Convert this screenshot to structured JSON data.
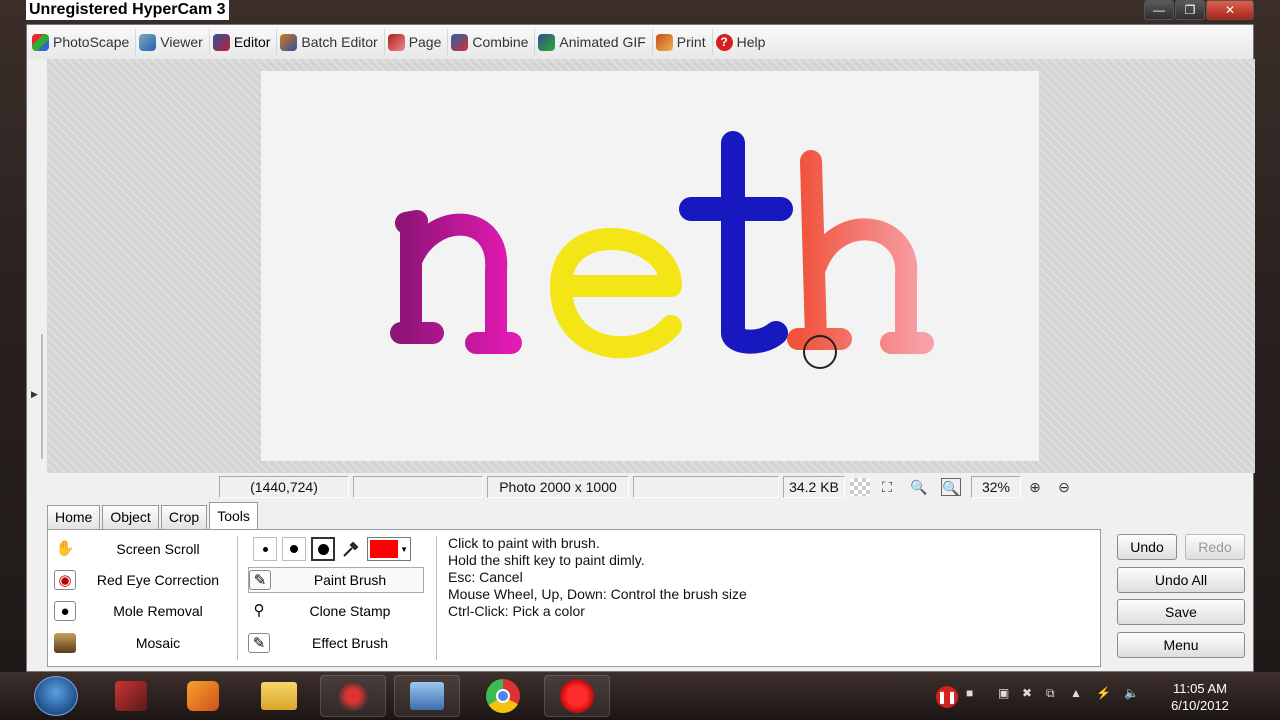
{
  "recorder": {
    "watermark": "Unregistered HyperCam 3"
  },
  "window_controls": {
    "minimize": "—",
    "maximize": "❐",
    "close": "✕"
  },
  "menu": {
    "items": [
      {
        "label": "PhotoScape",
        "icon": "photoscape-icon",
        "color": "#3a8f3a"
      },
      {
        "label": "Viewer",
        "icon": "viewer-icon",
        "color": "#3b6fb6"
      },
      {
        "label": "Editor",
        "icon": "editor-icon",
        "color": "#2d4fa0"
      },
      {
        "label": "Batch Editor",
        "icon": "batch-editor-icon",
        "color": "#d07a1a"
      },
      {
        "label": "Page",
        "icon": "page-icon",
        "color": "#b02020"
      },
      {
        "label": "Combine",
        "icon": "combine-icon",
        "color": "#2a5fb0"
      },
      {
        "label": "Animated GIF",
        "icon": "animated-gif-icon",
        "color": "#2a4f8a"
      },
      {
        "label": "Print",
        "icon": "print-icon",
        "color": "#c0501a"
      },
      {
        "label": "Help",
        "icon": "help-icon",
        "color": "#d62020"
      }
    ]
  },
  "photo": {
    "text": "neth",
    "letter_colors": [
      "#b0108a",
      "#f0e000",
      "#1518b8",
      "#f06a50"
    ]
  },
  "status": {
    "coords": "(1440,724)",
    "photo_size": "Photo 2000 x 1000",
    "file_size": "34.2 KB",
    "zoom": "32%"
  },
  "tabs": [
    {
      "label": "Home"
    },
    {
      "label": "Object"
    },
    {
      "label": "Crop"
    },
    {
      "label": "Tools"
    }
  ],
  "tools_left": [
    {
      "label": "Screen Scroll",
      "icon": "hand-icon"
    },
    {
      "label": "Red Eye Correction",
      "icon": "eye-icon"
    },
    {
      "label": "Mole Removal",
      "icon": "mole-icon"
    },
    {
      "label": "Mosaic",
      "icon": "mosaic-icon"
    }
  ],
  "tools_right": [
    {
      "label": "Paint Brush",
      "icon": "paint-brush-icon"
    },
    {
      "label": "Clone Stamp",
      "icon": "clone-stamp-icon"
    },
    {
      "label": "Effect Brush",
      "icon": "effect-brush-icon"
    }
  ],
  "brush": {
    "selected_color": "#ff0000"
  },
  "help_lines": [
    "Click to paint with brush.",
    "Hold the shift key to paint dimly.",
    "Esc: Cancel",
    "Mouse Wheel, Up, Down: Control the brush size",
    "Ctrl-Click: Pick a color"
  ],
  "actions": {
    "undo": "Undo",
    "redo": "Redo",
    "undo_all": "Undo All",
    "save": "Save",
    "menu": "Menu"
  },
  "taskbar": {
    "time": "11:05 AM",
    "date": "6/10/2012"
  }
}
